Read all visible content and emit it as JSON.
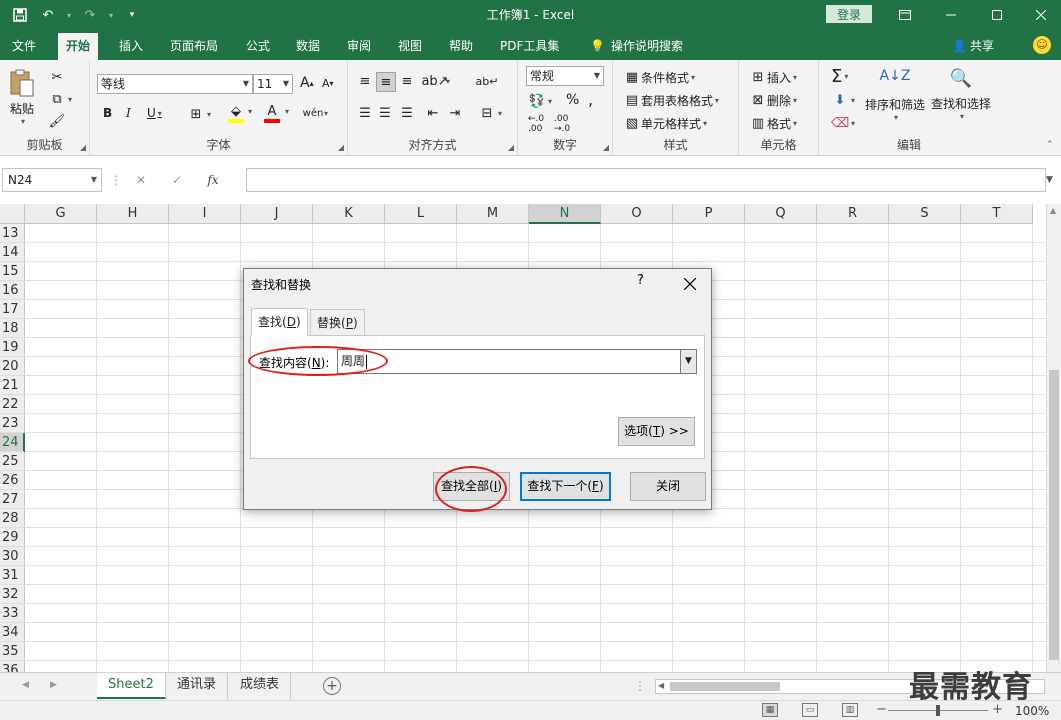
{
  "window": {
    "title": "工作簿1  -  Excel",
    "login": "登录"
  },
  "ribbon_tabs": [
    "文件",
    "开始",
    "插入",
    "页面布局",
    "公式",
    "数据",
    "审阅",
    "视图",
    "帮助",
    "PDF工具集",
    "操作说明搜索"
  ],
  "active_tab": "开始",
  "share": "共享",
  "clipboard": {
    "paste": "粘贴",
    "label": "剪贴板"
  },
  "font": {
    "name": "等线",
    "size": "11",
    "bold": "B",
    "italic": "I",
    "underline": "U",
    "grow": "A",
    "shrink": "A",
    "label": "字体",
    "fill_color": "#ffff00",
    "font_color": "#ff0000"
  },
  "alignment": {
    "label": "对齐方式"
  },
  "number": {
    "format": "常规",
    "percent": "%",
    "comma": ",",
    "label": "数字"
  },
  "styles": {
    "conditional": "条件格式",
    "table": "套用表格格式",
    "cell": "单元格样式",
    "label": "样式"
  },
  "cells": {
    "insert": "插入",
    "delete": "删除",
    "format": "格式",
    "label": "单元格"
  },
  "editing": {
    "sort": "排序和筛选",
    "find": "查找和选择",
    "label": "编辑"
  },
  "formula_bar": {
    "name_box": "N24",
    "fx": "fx",
    "cancel": "✕",
    "enter": "✓",
    "formula": ""
  },
  "columns": [
    "G",
    "H",
    "I",
    "J",
    "K",
    "L",
    "M",
    "N",
    "O",
    "P",
    "Q",
    "R",
    "S",
    "T"
  ],
  "selected_column": "N",
  "rows": [
    "13",
    "14",
    "15",
    "16",
    "17",
    "18",
    "19",
    "20",
    "21",
    "22",
    "23",
    "24",
    "25",
    "26",
    "27",
    "28",
    "29",
    "30",
    "31",
    "32",
    "33",
    "34",
    "35",
    "36"
  ],
  "selected_row": "24",
  "sheets": [
    "Sheet2",
    "通讯录",
    "成绩表"
  ],
  "active_sheet": "Sheet2",
  "status": {
    "zoom": "100%",
    "minus": "−",
    "plus": "+"
  },
  "dialog": {
    "title": "查找和替换",
    "help": "?",
    "close": "✕",
    "tab_find": "查找(",
    "tab_find_key": "D",
    "tab_find_end": ")",
    "tab_replace": "替换(",
    "tab_replace_key": "P",
    "tab_replace_end": ")",
    "find_label": "查找内容(",
    "find_label_key": "N",
    "find_label_end": "):",
    "find_value": "周周",
    "options_btn": "选项(",
    "options_key": "T",
    "options_end": ") >>",
    "find_all": "查找全部(",
    "find_all_key": "I",
    "find_all_end": ")",
    "find_next": "查找下一个(",
    "find_next_key": "F",
    "find_next_end": ")",
    "close_btn": "关闭"
  },
  "watermark": "最需教育"
}
